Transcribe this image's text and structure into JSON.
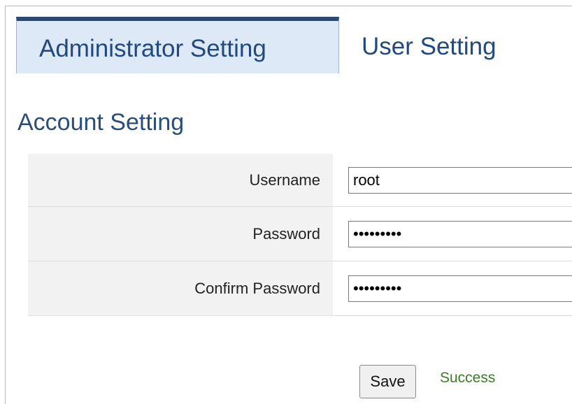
{
  "tabs": [
    {
      "label": "Administrator Setting",
      "active": true
    },
    {
      "label": "User Setting",
      "active": false
    }
  ],
  "section": {
    "title": "Account Setting"
  },
  "form": {
    "username": {
      "label": "Username",
      "value": "root"
    },
    "password": {
      "label": "Password",
      "value": "•••••••••"
    },
    "confirm_password": {
      "label": "Confirm Password",
      "value": "•••••••••"
    }
  },
  "actions": {
    "save_label": "Save",
    "status_text": "Success"
  },
  "colors": {
    "tab_active_bg": "#dde9f6",
    "tab_active_top_border": "#2b4b76",
    "heading_text": "#2a4d79",
    "status_success": "#3a7d24",
    "label_bg": "#f2f2f2"
  }
}
